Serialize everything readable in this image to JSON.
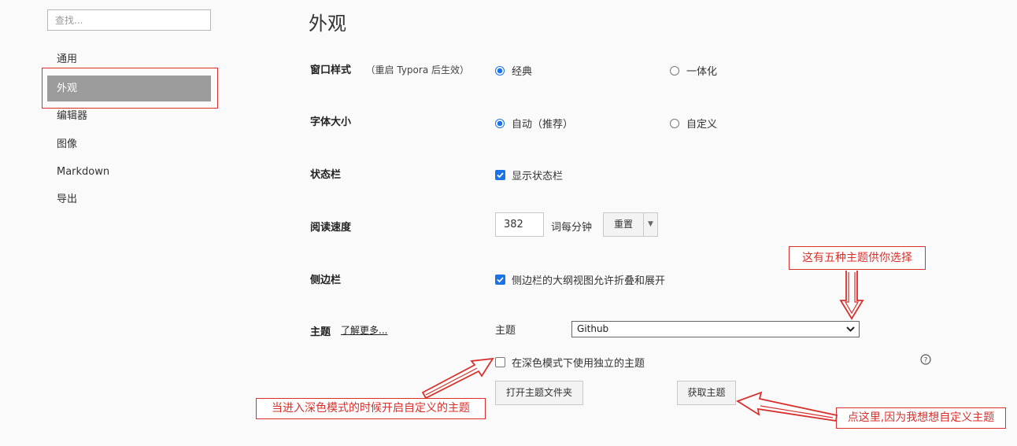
{
  "sidebar": {
    "search_placeholder": "查找...",
    "items": [
      {
        "label": "通用"
      },
      {
        "label": "外观"
      },
      {
        "label": "编辑器"
      },
      {
        "label": "图像"
      },
      {
        "label": "Markdown"
      },
      {
        "label": "导出"
      }
    ],
    "active_item": "外观"
  },
  "page_title": "外观",
  "settings": {
    "window_style": {
      "label": "窗口样式",
      "note": "（重启 Typora 后生效）",
      "options": [
        "经典",
        "一体化"
      ],
      "selected": "经典"
    },
    "font_size": {
      "label": "字体大小",
      "options": [
        "自动（推荐）",
        "自定义"
      ],
      "selected": "自动（推荐）"
    },
    "status_bar": {
      "label": "状态栏",
      "checkbox_label": "显示状态栏",
      "checked": true
    },
    "reading_speed": {
      "label": "阅读速度",
      "value": "382",
      "unit": "词每分钟",
      "reset_label": "重置"
    },
    "sidebar_setting": {
      "label": "侧边栏",
      "checkbox_label": "侧边栏的大纲视图允许折叠和展开",
      "checked": true
    },
    "theme": {
      "label": "主题",
      "learn_more": "了解更多...",
      "select_label": "主题",
      "selected_theme": "Github",
      "dark_mode_label": "在深色模式下使用独立的主题",
      "dark_mode_checked": false,
      "open_folder_label": "打开主题文件夹",
      "get_themes_label": "获取主题"
    }
  },
  "annotations": {
    "five_themes": "这有五种主题供你选择",
    "dark_mode_note": "当进入深色模式的时候开启自定义的主题",
    "click_here": "点这里,因为我想想自定义主题"
  },
  "colors": {
    "accent": "#1a73e8",
    "annotation_red": "#d9302b",
    "active_nav_bg": "#9b9b9b"
  }
}
